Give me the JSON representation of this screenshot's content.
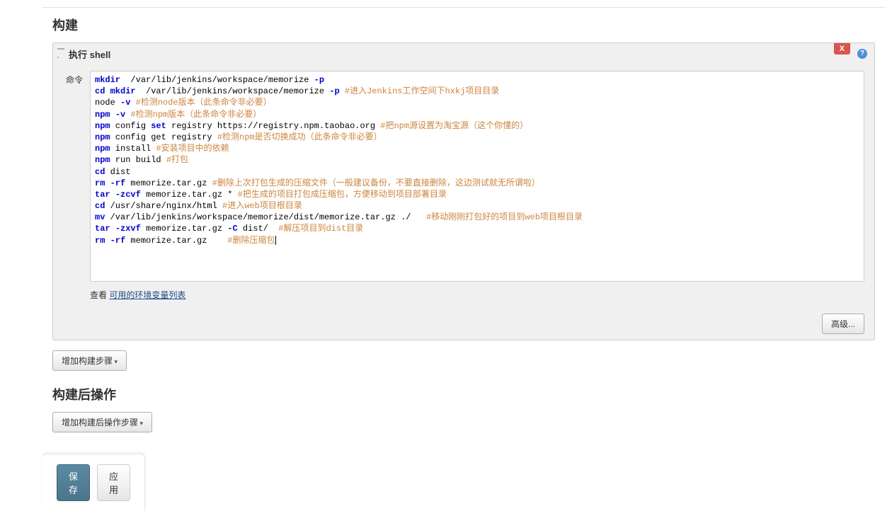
{
  "sections": {
    "build": {
      "title": "构建",
      "steps": [
        {
          "title": "执行 shell",
          "delete_label": "X",
          "command_label": "命令",
          "help_tooltip": "?"
        }
      ],
      "env_prefix": "查看 ",
      "env_link": "可用的环境变量列表",
      "advanced_label": "高级...",
      "add_step_label": "增加构建步骤"
    },
    "post_build": {
      "title": "构建后操作",
      "add_action_label": "增加构建后操作步骤"
    },
    "footer": {
      "save_label": "保存",
      "apply_label": "应用"
    }
  },
  "shell_command_lines": [
    {
      "segments": [
        {
          "t": "kw",
          "v": "mkdir"
        },
        {
          "t": "plain",
          "v": "  /var/lib/jenkins/workspace/memorize "
        },
        {
          "t": "dash",
          "v": "-p"
        }
      ]
    },
    {
      "segments": [
        {
          "t": "kw",
          "v": "cd mkdir"
        },
        {
          "t": "plain",
          "v": "  /var/lib/jenkins/workspace/memorize "
        },
        {
          "t": "dash",
          "v": "-p"
        },
        {
          "t": "plain",
          "v": " "
        },
        {
          "t": "cmt",
          "v": "#进入Jenkins工作空间下hxkj项目目录"
        }
      ]
    },
    {
      "segments": [
        {
          "t": "plain",
          "v": "node "
        },
        {
          "t": "dash",
          "v": "-v"
        },
        {
          "t": "plain",
          "v": " "
        },
        {
          "t": "cmt",
          "v": "#检测node版本（此条命令非必要）"
        }
      ]
    },
    {
      "segments": [
        {
          "t": "kw",
          "v": "npm"
        },
        {
          "t": "plain",
          "v": " "
        },
        {
          "t": "dash",
          "v": "-v"
        },
        {
          "t": "plain",
          "v": " "
        },
        {
          "t": "cmt",
          "v": "#检测npm版本（此条命令非必要）"
        }
      ]
    },
    {
      "segments": [
        {
          "t": "kw",
          "v": "npm"
        },
        {
          "t": "plain",
          "v": " config "
        },
        {
          "t": "kw",
          "v": "set"
        },
        {
          "t": "plain",
          "v": " registry https://registry.npm.taobao.org "
        },
        {
          "t": "cmt",
          "v": "#把npm源设置为淘宝源（这个你懂的）"
        }
      ]
    },
    {
      "segments": [
        {
          "t": "kw",
          "v": "npm"
        },
        {
          "t": "plain",
          "v": " config get registry "
        },
        {
          "t": "cmt",
          "v": "#检测npm是否切换成功（此条命令非必要）"
        }
      ]
    },
    {
      "segments": [
        {
          "t": "kw",
          "v": "npm"
        },
        {
          "t": "plain",
          "v": " install "
        },
        {
          "t": "cmt",
          "v": "#安装项目中的依赖"
        }
      ]
    },
    {
      "segments": [
        {
          "t": "kw",
          "v": "npm"
        },
        {
          "t": "plain",
          "v": " run build "
        },
        {
          "t": "cmt",
          "v": "#打包"
        }
      ]
    },
    {
      "segments": [
        {
          "t": "kw",
          "v": "cd"
        },
        {
          "t": "plain",
          "v": " dist"
        }
      ]
    },
    {
      "segments": [
        {
          "t": "kw",
          "v": "rm"
        },
        {
          "t": "plain",
          "v": " "
        },
        {
          "t": "dash",
          "v": "-rf"
        },
        {
          "t": "plain",
          "v": " memorize.tar.gz "
        },
        {
          "t": "cmt",
          "v": "#删除上次打包生成的压缩文件（一般建议备份，不要直接删除，这边测试就无所谓啦）"
        }
      ]
    },
    {
      "segments": [
        {
          "t": "kw",
          "v": "tar"
        },
        {
          "t": "plain",
          "v": " "
        },
        {
          "t": "dash",
          "v": "-zcvf"
        },
        {
          "t": "plain",
          "v": " memorize.tar.gz * "
        },
        {
          "t": "cmt",
          "v": "#把生成的项目打包成压缩包，方便移动到项目部署目录"
        }
      ]
    },
    {
      "segments": [
        {
          "t": "kw",
          "v": "cd"
        },
        {
          "t": "plain",
          "v": " /usr/share/nginx/html "
        },
        {
          "t": "cmt",
          "v": "#进入web项目根目录"
        }
      ]
    },
    {
      "segments": [
        {
          "t": "kw",
          "v": "mv"
        },
        {
          "t": "plain",
          "v": " /var/lib/jenkins/workspace/memorize/dist/memorize.tar.gz ./   "
        },
        {
          "t": "cmt",
          "v": "#移动刚刚打包好的项目到web项目根目录"
        }
      ]
    },
    {
      "segments": [
        {
          "t": "kw",
          "v": "tar"
        },
        {
          "t": "plain",
          "v": " "
        },
        {
          "t": "dash",
          "v": "-zxvf"
        },
        {
          "t": "plain",
          "v": " memorize.tar.gz "
        },
        {
          "t": "dash",
          "v": "-C"
        },
        {
          "t": "plain",
          "v": " dist/  "
        },
        {
          "t": "cmt",
          "v": "#解压项目到dist目录"
        }
      ]
    },
    {
      "segments": [
        {
          "t": "kw",
          "v": "rm"
        },
        {
          "t": "plain",
          "v": " "
        },
        {
          "t": "dash",
          "v": "-rf"
        },
        {
          "t": "plain",
          "v": " memorize.tar.gz    "
        },
        {
          "t": "cmt",
          "v": "#删除压缩包"
        }
      ]
    }
  ]
}
